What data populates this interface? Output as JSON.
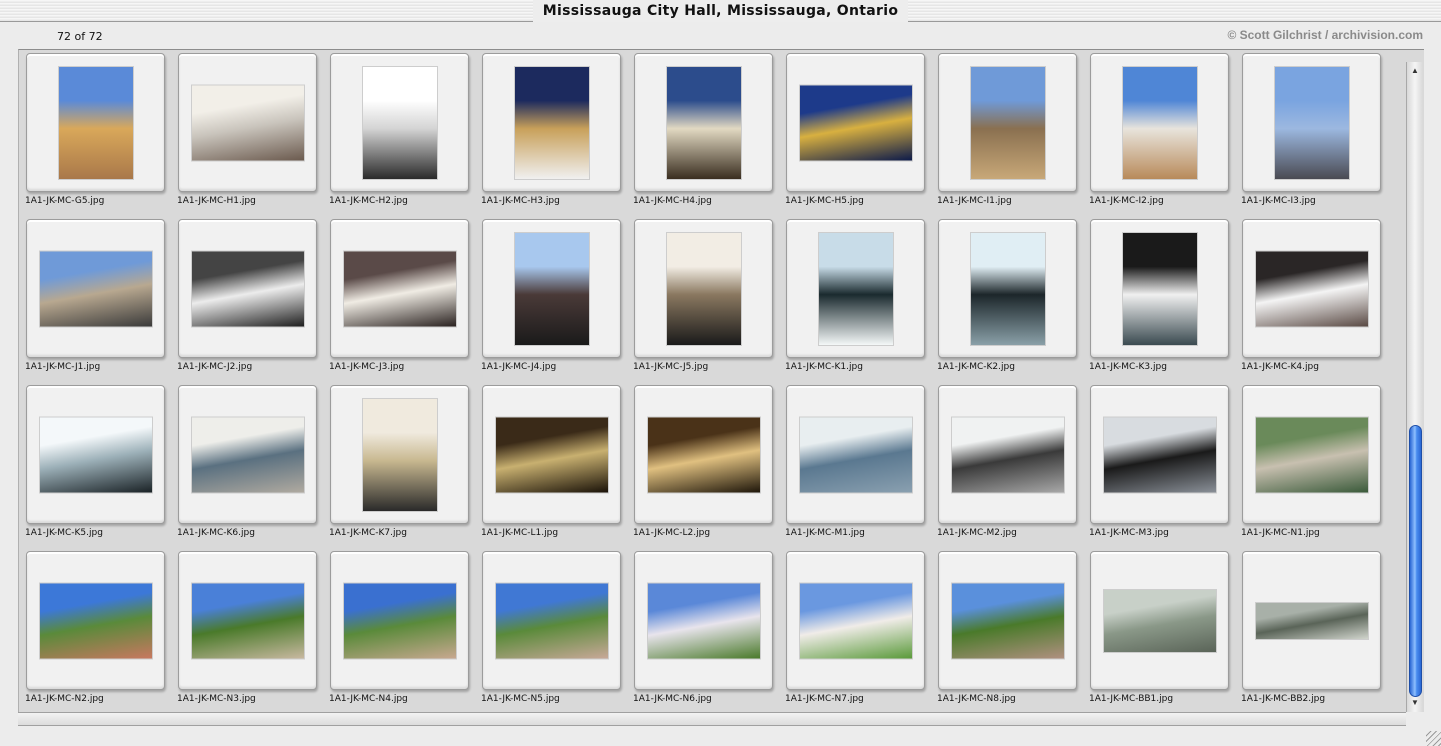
{
  "window": {
    "title": "Mississauga City Hall, Mississauga, Ontario"
  },
  "info": {
    "count": "72 of 72",
    "copyright": "© Scott Gilchrist / archivision.com"
  },
  "icons": {
    "scroll_up": "up-arrow-icon",
    "scroll_down": "down-arrow-icon",
    "resize": "resize-grip-icon"
  },
  "thumbnails": [
    {
      "file": "1A1-JK-MC-G5.jpg",
      "shape": "p",
      "colors": [
        "#5a8ad8",
        "#d9a85a",
        "#a9784a"
      ]
    },
    {
      "file": "1A1-JK-MC-H1.jpg",
      "shape": "l",
      "colors": [
        "#f2efe8",
        "#c9c4bc",
        "#6b5a4e"
      ]
    },
    {
      "file": "1A1-JK-MC-H2.jpg",
      "shape": "p",
      "colors": [
        "#ffffff",
        "#d4d4d4",
        "#2a2a2a"
      ]
    },
    {
      "file": "1A1-JK-MC-H3.jpg",
      "shape": "p",
      "colors": [
        "#1c2a5e",
        "#c8a05a",
        "#f0f0f0"
      ]
    },
    {
      "file": "1A1-JK-MC-H4.jpg",
      "shape": "p",
      "colors": [
        "#2c4c8c",
        "#e2d9c2",
        "#3a2e20"
      ]
    },
    {
      "file": "1A1-JK-MC-H5.jpg",
      "shape": "l",
      "colors": [
        "#1d3a8a",
        "#d8b040",
        "#0c1a4a"
      ]
    },
    {
      "file": "1A1-JK-MC-I1.jpg",
      "shape": "p",
      "colors": [
        "#6f9ad8",
        "#8a7050",
        "#c8a878"
      ]
    },
    {
      "file": "1A1-JK-MC-I2.jpg",
      "shape": "p",
      "colors": [
        "#4f86d6",
        "#e8e4dc",
        "#b88a5a"
      ]
    },
    {
      "file": "1A1-JK-MC-I3.jpg",
      "shape": "p",
      "colors": [
        "#7aa4e0",
        "#9cb8e0",
        "#4a4a52"
      ]
    },
    {
      "file": "1A1-JK-MC-J1.jpg",
      "shape": "l",
      "colors": [
        "#6f9ad8",
        "#b8a890",
        "#3a3a3a"
      ]
    },
    {
      "file": "1A1-JK-MC-J2.jpg",
      "shape": "l",
      "colors": [
        "#444444",
        "#ececec",
        "#1e1e1e"
      ]
    },
    {
      "file": "1A1-JK-MC-J3.jpg",
      "shape": "l",
      "colors": [
        "#5a4a48",
        "#f0ece4",
        "#2a2220"
      ]
    },
    {
      "file": "1A1-JK-MC-J4.jpg",
      "shape": "p",
      "colors": [
        "#a8c8ee",
        "#4a3a38",
        "#1a1a1a"
      ]
    },
    {
      "file": "1A1-JK-MC-J5.jpg",
      "shape": "p",
      "colors": [
        "#f2ede4",
        "#8a7860",
        "#1a1a1a"
      ]
    },
    {
      "file": "1A1-JK-MC-K1.jpg",
      "shape": "p",
      "colors": [
        "#c8dce8",
        "#1a2a2e",
        "#f4f8f8"
      ]
    },
    {
      "file": "1A1-JK-MC-K2.jpg",
      "shape": "p",
      "colors": [
        "#e0eef4",
        "#1c262a",
        "#8aa0a8"
      ]
    },
    {
      "file": "1A1-JK-MC-K3.jpg",
      "shape": "p",
      "colors": [
        "#1a1a1a",
        "#f0f0f0",
        "#3a4a50"
      ]
    },
    {
      "file": "1A1-JK-MC-K4.jpg",
      "shape": "l",
      "colors": [
        "#2a2626",
        "#f4f4f4",
        "#5a4a44"
      ]
    },
    {
      "file": "1A1-JK-MC-K5.jpg",
      "shape": "l",
      "colors": [
        "#f4f8fa",
        "#9cb0b8",
        "#1a2226"
      ]
    },
    {
      "file": "1A1-JK-MC-K6.jpg",
      "shape": "l",
      "colors": [
        "#eeeeea",
        "#5a7080",
        "#b0aaa0"
      ]
    },
    {
      "file": "1A1-JK-MC-K7.jpg",
      "shape": "p",
      "colors": [
        "#f0eade",
        "#c8b890",
        "#2a2a2a"
      ]
    },
    {
      "file": "1A1-JK-MC-L1.jpg",
      "shape": "l",
      "colors": [
        "#3a2a18",
        "#c8b070",
        "#1a1208"
      ]
    },
    {
      "file": "1A1-JK-MC-L2.jpg",
      "shape": "l",
      "colors": [
        "#4a3218",
        "#e0c080",
        "#1e160a"
      ]
    },
    {
      "file": "1A1-JK-MC-M1.jpg",
      "shape": "l",
      "colors": [
        "#e8eef0",
        "#5a7890",
        "#8aa0b0"
      ]
    },
    {
      "file": "1A1-JK-MC-M2.jpg",
      "shape": "l",
      "colors": [
        "#f0f2f2",
        "#3a3a3a",
        "#a8a8a8"
      ]
    },
    {
      "file": "1A1-JK-MC-M3.jpg",
      "shape": "l",
      "colors": [
        "#d8dce0",
        "#1a1a1a",
        "#8a9098"
      ]
    },
    {
      "file": "1A1-JK-MC-N1.jpg",
      "shape": "l",
      "colors": [
        "#6a8a5a",
        "#c8c0b0",
        "#3a5a3a"
      ]
    },
    {
      "file": "1A1-JK-MC-N2.jpg",
      "shape": "l",
      "colors": [
        "#3c78d8",
        "#5a8a3a",
        "#c87860"
      ]
    },
    {
      "file": "1A1-JK-MC-N3.jpg",
      "shape": "l",
      "colors": [
        "#4a80d8",
        "#4a7a2a",
        "#c8b8a0"
      ]
    },
    {
      "file": "1A1-JK-MC-N4.jpg",
      "shape": "l",
      "colors": [
        "#3a70d0",
        "#5a8a3a",
        "#c8a890"
      ]
    },
    {
      "file": "1A1-JK-MC-N5.jpg",
      "shape": "l",
      "colors": [
        "#4078d4",
        "#5a8a3a",
        "#c8a898"
      ]
    },
    {
      "file": "1A1-JK-MC-N6.jpg",
      "shape": "l",
      "colors": [
        "#5a88d8",
        "#e8e4ec",
        "#4a7a2a"
      ]
    },
    {
      "file": "1A1-JK-MC-N7.jpg",
      "shape": "l",
      "colors": [
        "#6a98e0",
        "#f0ece8",
        "#5a9a3a"
      ]
    },
    {
      "file": "1A1-JK-MC-N8.jpg",
      "shape": "l",
      "colors": [
        "#5a90dc",
        "#4a7a2a",
        "#b09080"
      ]
    },
    {
      "file": "1A1-JK-MC-BB1.jpg",
      "shape": "w",
      "colors": [
        "#c8d0c8",
        "#8a9888",
        "#5a6458"
      ]
    },
    {
      "file": "1A1-JK-MC-BB2.jpg",
      "shape": "s",
      "colors": [
        "#a8b0a8",
        "#5a6458",
        "#d0d4cc"
      ]
    }
  ]
}
